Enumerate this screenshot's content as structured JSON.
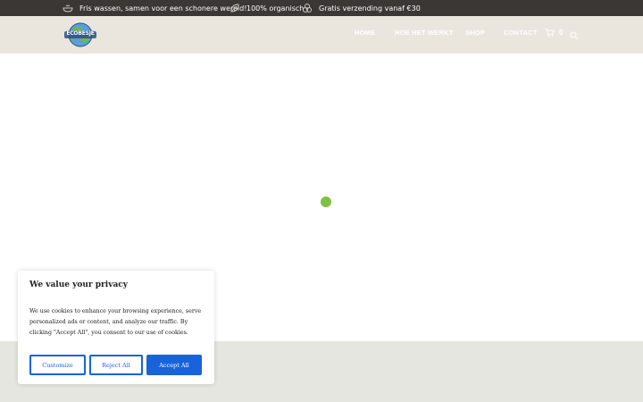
{
  "topbar": {
    "items": [
      {
        "icon": "washing-bowl-icon",
        "text": "Fris wassen, samen voor een schonere wereld!"
      },
      {
        "icon": "leaf-icon",
        "text": "100% organisch"
      },
      {
        "icon": "shipping-box-icon",
        "text": "Gratis verzending vanaf €30"
      }
    ]
  },
  "header": {
    "logo_text": "ECOBESJE",
    "nav": [
      {
        "label": "HOME"
      },
      {
        "label": "HOE HET WERKT"
      },
      {
        "label": "SHOP"
      },
      {
        "label": "CONTACT"
      }
    ],
    "cart_count": "0"
  },
  "loader": {
    "color": "#7fc241"
  },
  "cookie": {
    "title": "We value your privacy",
    "text": "We use cookies to enhance your browsing experience, serve personalized ads or content, and analyze our traffic. By clicking \"Accept All\", you consent to our use of cookies.",
    "customize_label": "Customize",
    "reject_label": "Reject All",
    "accept_label": "Accept All",
    "accent_color": "#1863dc"
  }
}
